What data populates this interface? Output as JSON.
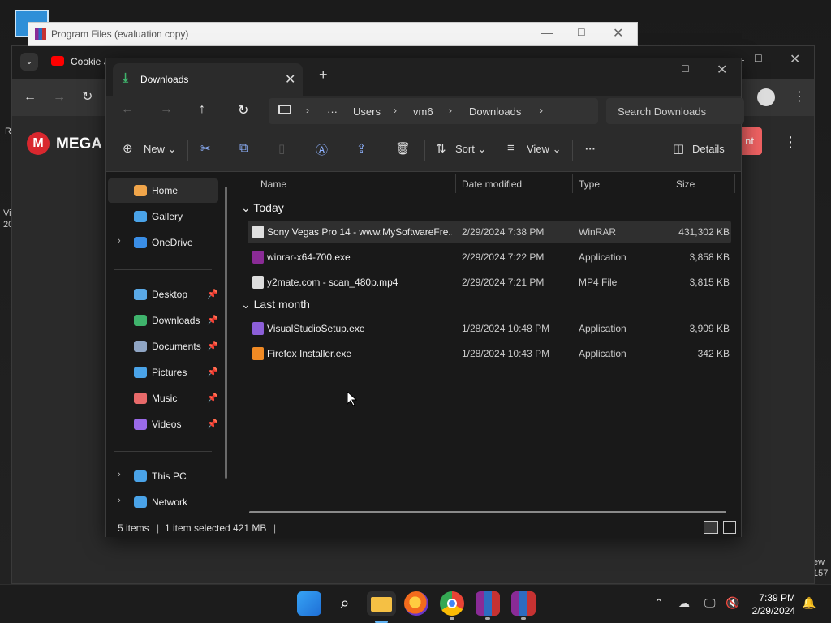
{
  "background": {
    "chrome_tab_label": "Cookie J",
    "mega_text": "MEGA",
    "mega_logo_letter": "M",
    "mega_button_label": "nt",
    "desktop_text_1": "R",
    "desktop_text_2a": "Vi",
    "desktop_text_2b": "20",
    "desktop_text_3a": "ew",
    "desktop_text_3b": "157"
  },
  "rar_window": {
    "title": "Program Files (evaluation copy)"
  },
  "explorer": {
    "tab_title": "Downloads",
    "breadcrumb": [
      "Users",
      "vm6",
      "Downloads"
    ],
    "breadcrumb_more": "···",
    "search_placeholder": "Search Downloads",
    "toolbar": {
      "new_label": "New",
      "sort_label": "Sort",
      "view_label": "View",
      "more_label": "···",
      "details_label": "Details"
    },
    "nav": [
      {
        "label": "Home",
        "icon": "home-icon",
        "color": "#f0a54a",
        "pinned": false,
        "expandable": false,
        "active": true
      },
      {
        "label": "Gallery",
        "icon": "gallery-icon",
        "color": "#4aa3e8",
        "pinned": false,
        "expandable": false,
        "active": false
      },
      {
        "label": "OneDrive",
        "icon": "cloud-icon",
        "color": "#3a8ee6",
        "pinned": false,
        "expandable": true,
        "active": false
      },
      {
        "label": "Desktop",
        "icon": "desktop-icon",
        "color": "#5aa9e6",
        "pinned": true,
        "expandable": false,
        "active": false
      },
      {
        "label": "Downloads",
        "icon": "download-icon",
        "color": "#3fb36c",
        "pinned": true,
        "expandable": false,
        "active": false
      },
      {
        "label": "Documents",
        "icon": "documents-icon",
        "color": "#8fa5c4",
        "pinned": true,
        "expandable": false,
        "active": false
      },
      {
        "label": "Pictures",
        "icon": "pictures-icon",
        "color": "#4aa3e8",
        "pinned": true,
        "expandable": false,
        "active": false
      },
      {
        "label": "Music",
        "icon": "music-icon",
        "color": "#e86a6a",
        "pinned": true,
        "expandable": false,
        "active": false
      },
      {
        "label": "Videos",
        "icon": "videos-icon",
        "color": "#9a6ae8",
        "pinned": true,
        "expandable": false,
        "active": false
      },
      {
        "label": "This PC",
        "icon": "pc-icon",
        "color": "#4aa3e8",
        "pinned": false,
        "expandable": true,
        "active": false
      },
      {
        "label": "Network",
        "icon": "network-icon",
        "color": "#4aa3e8",
        "pinned": false,
        "expandable": true,
        "active": false
      }
    ],
    "columns": {
      "name": "Name",
      "date": "Date modified",
      "type": "Type",
      "size": "Size"
    },
    "groups": [
      {
        "label": "Today",
        "files": [
          {
            "name": "Sony Vegas Pro 14 - www.MySoftwareFre...",
            "date": "2/29/2024 7:38 PM",
            "type": "WinRAR",
            "size": "431,302 KB",
            "icon": "document-icon",
            "icon_color": "#e0e0e0",
            "selected": true
          },
          {
            "name": "winrar-x64-700.exe",
            "date": "2/29/2024 7:22 PM",
            "type": "Application",
            "size": "3,858 KB",
            "icon": "winrar-icon",
            "icon_color": "#8a2b96",
            "selected": false
          },
          {
            "name": "y2mate.com - scan_480p.mp4",
            "date": "2/29/2024 7:21 PM",
            "type": "MP4 File",
            "size": "3,815 KB",
            "icon": "video-file-icon",
            "icon_color": "#dddddd",
            "selected": false
          }
        ]
      },
      {
        "label": "Last month",
        "files": [
          {
            "name": "VisualStudioSetup.exe",
            "date": "1/28/2024 10:48 PM",
            "type": "Application",
            "size": "3,909 KB",
            "icon": "visualstudio-icon",
            "icon_color": "#8c5fd8",
            "selected": false
          },
          {
            "name": "Firefox Installer.exe",
            "date": "1/28/2024 10:43 PM",
            "type": "Application",
            "size": "342 KB",
            "icon": "firefox-icon",
            "icon_color": "#f08a24",
            "selected": false
          }
        ]
      }
    ],
    "status": {
      "count": "5 items",
      "selection": "1 item selected  421 MB"
    }
  },
  "taskbar": {
    "time": "7:39 PM",
    "date": "2/29/2024"
  }
}
